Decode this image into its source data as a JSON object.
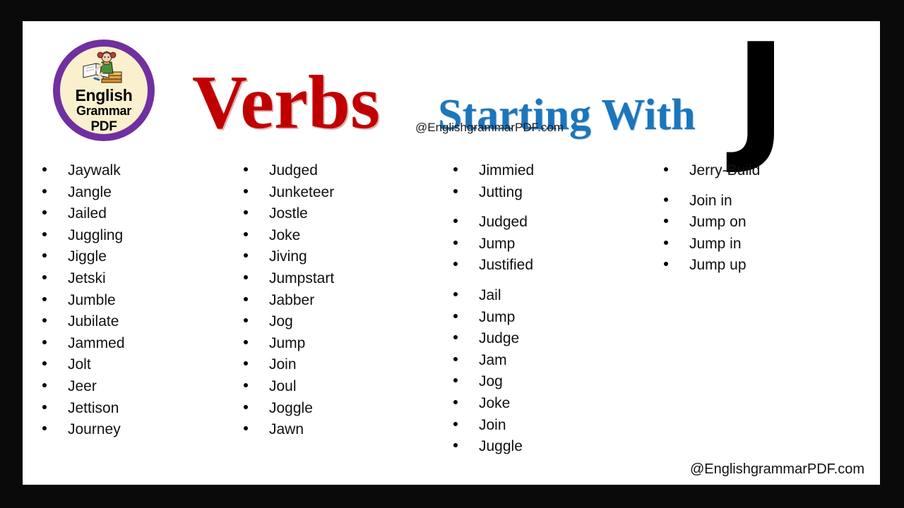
{
  "page": {
    "frame_color": "#0a0a0a",
    "sheet_color": "#ffffff"
  },
  "logo": {
    "line1": "English",
    "line2": "Grammar",
    "line3": "PDF",
    "ring_color": "#7030A0",
    "face_color": "#FAF0CD",
    "art_name": "girl-reading-books-illustration"
  },
  "title": {
    "word_primary": "Verbs",
    "word_secondary": "Starting With",
    "letter": "J",
    "primary_color": "#C00000",
    "secondary_color": "#1B76BD",
    "letter_color": "#000000"
  },
  "watermarks": {
    "header": "@EnglishgrammarPDF.com",
    "footer": "@EnglishgrammarPDF.com"
  },
  "columns": [
    {
      "index": 0,
      "items": [
        {
          "label": "Jaywalk",
          "gap_before": false
        },
        {
          "label": "Jangle",
          "gap_before": false
        },
        {
          "label": "Jailed",
          "gap_before": false
        },
        {
          "label": "Juggling",
          "gap_before": false
        },
        {
          "label": "Jiggle",
          "gap_before": false
        },
        {
          "label": "Jetski",
          "gap_before": false
        },
        {
          "label": "Jumble",
          "gap_before": false
        },
        {
          "label": "Jubilate",
          "gap_before": false
        },
        {
          "label": "Jammed",
          "gap_before": false
        },
        {
          "label": "Jolt",
          "gap_before": false
        },
        {
          "label": "Jeer",
          "gap_before": false
        },
        {
          "label": "Jettison",
          "gap_before": false
        },
        {
          "label": "Journey",
          "gap_before": false
        }
      ]
    },
    {
      "index": 1,
      "items": [
        {
          "label": "Judged",
          "gap_before": false
        },
        {
          "label": "Junketeer",
          "gap_before": false
        },
        {
          "label": "Jostle",
          "gap_before": false
        },
        {
          "label": "Joke",
          "gap_before": false
        },
        {
          "label": "Jiving",
          "gap_before": false
        },
        {
          "label": "Jumpstart",
          "gap_before": false
        },
        {
          "label": "Jabber",
          "gap_before": false
        },
        {
          "label": "Jog",
          "gap_before": false
        },
        {
          "label": "Jump",
          "gap_before": false
        },
        {
          "label": "Join",
          "gap_before": false
        },
        {
          "label": "Joul",
          "gap_before": false
        },
        {
          "label": "Joggle",
          "gap_before": false
        },
        {
          "label": "Jawn",
          "gap_before": false
        }
      ]
    },
    {
      "index": 2,
      "items": [
        {
          "label": "Jimmied",
          "gap_before": false
        },
        {
          "label": "Jutting",
          "gap_before": false
        },
        {
          "label": "Judged",
          "gap_before": true
        },
        {
          "label": "Jump",
          "gap_before": false
        },
        {
          "label": "Justified",
          "gap_before": false
        },
        {
          "label": "Jail",
          "gap_before": true
        },
        {
          "label": "Jump",
          "gap_before": false
        },
        {
          "label": "Judge",
          "gap_before": false
        },
        {
          "label": "Jam",
          "gap_before": false
        },
        {
          "label": "Jog",
          "gap_before": false
        },
        {
          "label": "Joke",
          "gap_before": false
        },
        {
          "label": "Join",
          "gap_before": false
        },
        {
          "label": "Juggle",
          "gap_before": false
        }
      ]
    },
    {
      "index": 3,
      "items": [
        {
          "label": "Jerry-Build",
          "gap_before": false
        },
        {
          "label": "Join in",
          "gap_before": true
        },
        {
          "label": "Jump on",
          "gap_before": false
        },
        {
          "label": "Jump in",
          "gap_before": false
        },
        {
          "label": "Jump up",
          "gap_before": false
        }
      ]
    }
  ]
}
